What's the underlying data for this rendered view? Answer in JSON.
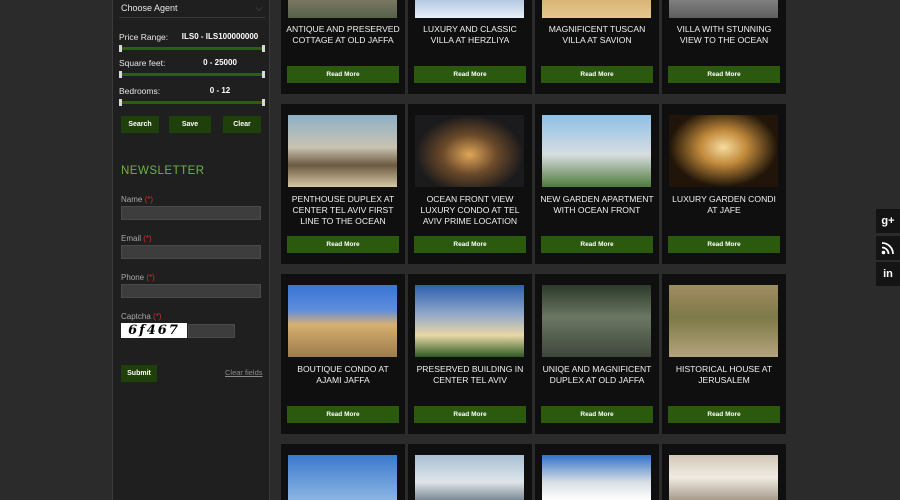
{
  "search": {
    "agent_label": "Choose Agent",
    "price_label": "Price Range:",
    "price_value": "ILS0 - ILS100000000",
    "sqft_label": "Square feet:",
    "sqft_value": "0 - 25000",
    "bedrooms_label": "Bedrooms:",
    "bedrooms_value": "0 - 12",
    "search_btn": "Search",
    "save_btn": "Save",
    "clear_btn": "Clear"
  },
  "newsletter": {
    "title": "NEWSLETTER",
    "name_label": "Name",
    "email_label": "Email",
    "phone_label": "Phone",
    "captcha_label": "Captcha",
    "required_mark": "(*)",
    "captcha_code": "6f467",
    "submit_btn": "Submit",
    "clear_link": "Clear fields"
  },
  "listings": {
    "read_more": "Read More",
    "items": [
      {
        "title": "ANTIQUE AND PRESERVED COTTAGE AT OLD JAFFA"
      },
      {
        "title": "LUXURY AND CLASSIC VILLA AT HERZLIYA"
      },
      {
        "title": "MAGNIFICENT TUSCAN VILLA AT SAVION"
      },
      {
        "title": "VILLA WITH STUNNING VIEW TO THE OCEAN"
      },
      {
        "title": "PENTHOUSE DUPLEX AT CENTER TEL AVIV FIRST LINE TO THE OCEAN"
      },
      {
        "title": "OCEAN FRONT VIEW LUXURY CONDO AT TEL AVIV PRIME LOCATION"
      },
      {
        "title": "NEW GARDEN APARTMENT WITH OCEAN FRONT"
      },
      {
        "title": "LUXURY GARDEN CONDI AT JAFE"
      },
      {
        "title": "BOUTIQUE CONDO AT AJAMI JAFFA"
      },
      {
        "title": "PRESERVED BUILDING IN CENTER TEL AVIV"
      },
      {
        "title": "UNIQE AND MAGNIFICENT DUPLEX AT OLD JAFFA"
      },
      {
        "title": "HISTORICAL HOUSE AT JERUSALEM"
      }
    ]
  },
  "social": {
    "google_plus": "g+",
    "rss": "rss",
    "linkedin": "in"
  }
}
